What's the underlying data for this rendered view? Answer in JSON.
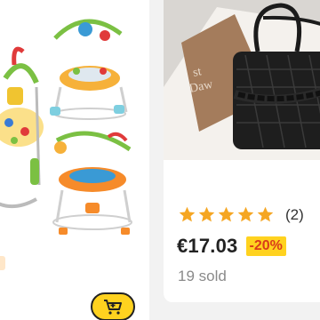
{
  "left_card": {
    "image_alt": "baby jumper activity center",
    "cart_icon": "cart-icon"
  },
  "right_card": {
    "image_alt": "black quilted handbag with chain",
    "rating": {
      "stars": 5,
      "count": "(2)"
    },
    "price": "€17.03",
    "discount": "-20%",
    "sold": "19 sold"
  },
  "colors": {
    "accent_yellow": "#ffd21f",
    "star_color": "#f5a623",
    "discount_text": "#d93b1a",
    "page_bg": "#f2f2f2"
  }
}
